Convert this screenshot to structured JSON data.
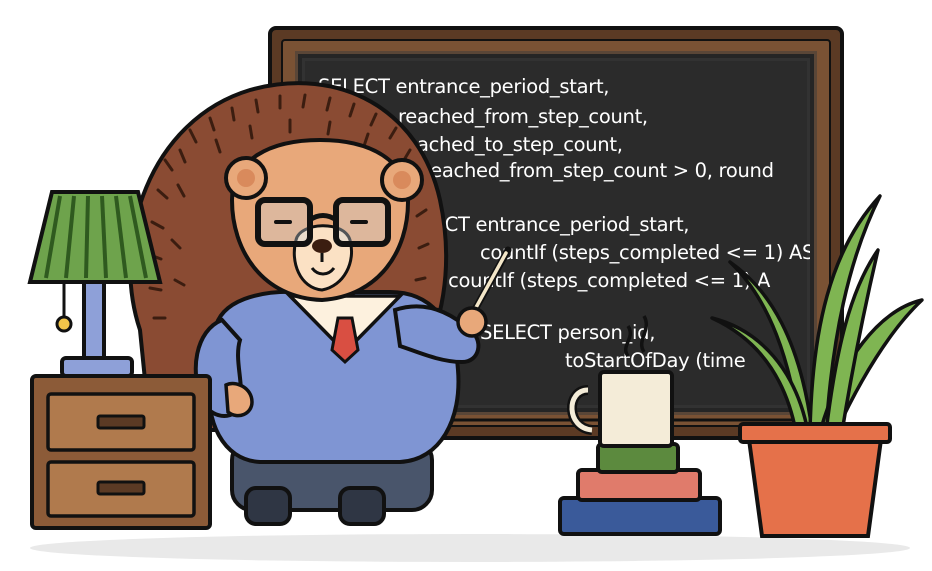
{
  "chalkboard": {
    "lines": [
      "SELECT entrance_period_start,",
      "reached_from_step_count,",
      "reached_to_step_count,",
      "if (reached_from_step_count > 0, round",
      "SELECT entrance_period_start,",
      "countIf (steps_completed <= 1) AS",
      "from countIf (steps_completed <= 1) A",
      "SELECT person_id,",
      "toStartOfDay (time"
    ]
  },
  "icons": [
    "chalkboard-icon",
    "hedgehog-teacher-icon",
    "table-lamp-icon",
    "nightstand-icon",
    "coffee-mug-icon",
    "book-stack-icon",
    "potted-plant-icon"
  ],
  "colors": {
    "board_frame": "#5b3a24",
    "board_surface": "#2b2b2b",
    "sweater": "#7f95d3",
    "skin": "#e8a87a",
    "spines": "#8a4b33",
    "pot": "#e5714a",
    "plant": "#6fa34a"
  }
}
